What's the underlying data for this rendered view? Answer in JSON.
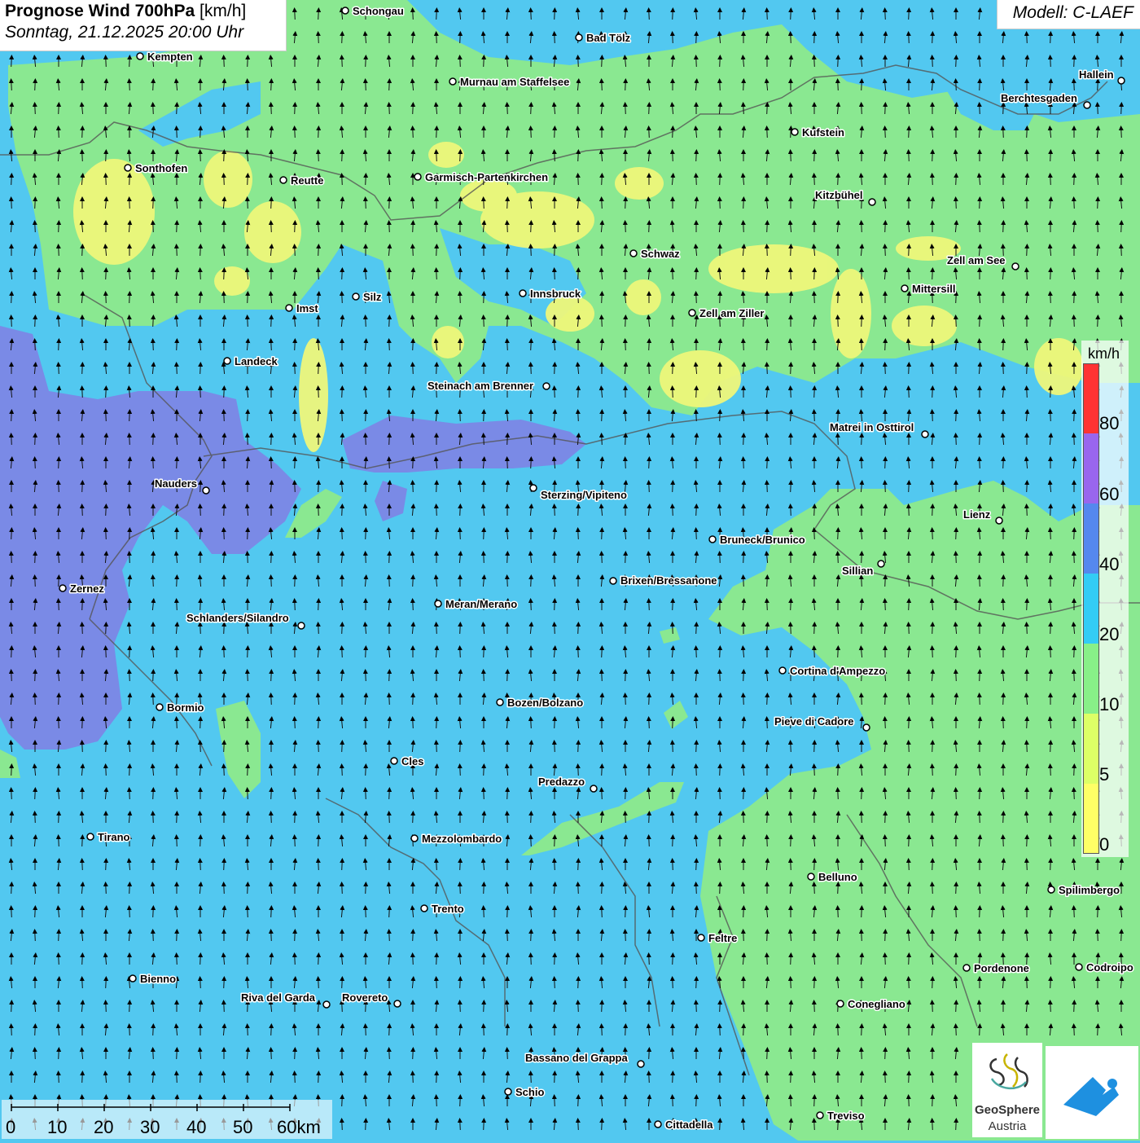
{
  "header": {
    "title_bold": "Prognose Wind 700hPa",
    "title_unit": "[km/h]",
    "subtitle": "Sonntag, 21.12.2025 20:00 Uhr"
  },
  "model": {
    "label": "Modell: C-LAEF"
  },
  "legend": {
    "unit": "km/h",
    "ticks": [
      "80",
      "60",
      "40",
      "20",
      "10",
      "5",
      "0"
    ],
    "colors": [
      "#ff3333",
      "#9966ee",
      "#5588ee",
      "#33ccf5",
      "#88f088",
      "#ddff66",
      "#ffff66"
    ]
  },
  "scale_bar": {
    "labels": [
      "0",
      "10",
      "20",
      "30",
      "40",
      "50",
      "60km"
    ]
  },
  "cities": [
    "Schongau",
    "Bad Tölz",
    "Kempten",
    "Murnau am Staffelsee",
    "Hallein",
    "Berchtesgaden",
    "Kufstein",
    "Sonthofen",
    "Reutte",
    "Garmisch-Partenkirchen",
    "Kitzbühel",
    "Schwaz",
    "Zell am See",
    "Mittersill",
    "Innsbruck",
    "Silz",
    "Imst",
    "Zell am Ziller",
    "Landeck",
    "Steinach am Brenner",
    "Matrei in Osttirol",
    "Nauders",
    "Sterzing/Vipiteno",
    "Lienz",
    "Bruneck/Brunico",
    "Sillian",
    "Brixen/Bressanone",
    "Zernez",
    "Meran/Merano",
    "Schlanders/Silandro",
    "Cortina d'Ampezzo",
    "Bozen/Bolzano",
    "Bormio",
    "Pieve di Cadore",
    "Cles",
    "Predazzo",
    "Tirano",
    "Mezzolombardo",
    "Belluno",
    "Spilimbergo",
    "Trento",
    "Feltre",
    "Pordenone",
    "Codroipo",
    "Bienno",
    "Riva del Garda",
    "Rovereto",
    "Conegliano",
    "Bassano del Grappa",
    "Schio",
    "Treviso",
    "Cittadella"
  ],
  "logos": {
    "geosphere_line1": "GeoSphere",
    "geosphere_line2": "Austria"
  },
  "colors": {
    "zone_0_5": "#eef77a",
    "zone_5_10": "#b0ef8c",
    "zone_10_20": "#8ae891",
    "zone_20_40": "#52c8f0",
    "zone_40_60": "#7a8ae6"
  }
}
